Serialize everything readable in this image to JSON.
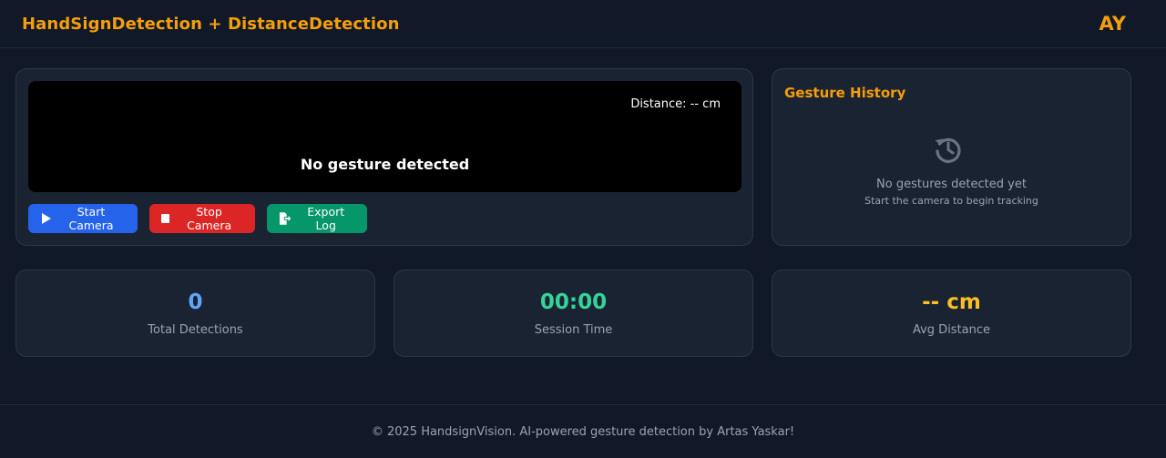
{
  "header": {
    "title": "HandSignDetection + DistanceDetection",
    "avatar": "AY"
  },
  "camera": {
    "distance_overlay": "Distance: -- cm",
    "gesture_status": "No gesture detected",
    "buttons": {
      "start": "Start Camera",
      "stop": "Stop Camera",
      "export": "Export Log"
    }
  },
  "history": {
    "title": "Gesture History",
    "icon": "history-icon",
    "empty_title": "No gestures detected yet",
    "empty_subtitle": "Start the camera to begin tracking"
  },
  "stats": [
    {
      "value": "0",
      "label": "Total Detections",
      "color": "#60a5fa"
    },
    {
      "value": "00:00",
      "label": "Session Time",
      "color": "#34d399"
    },
    {
      "value": "-- cm",
      "label": "Avg Distance",
      "color": "#fbbf24"
    }
  ],
  "footer": {
    "text": "© 2025 HandsignVision. AI-powered gesture detection by Artas Yaskar!"
  },
  "colors": {
    "accent": "#f59e0b",
    "start_button": "#2563eb",
    "stop_button": "#dc2626",
    "export_button": "#059669"
  }
}
